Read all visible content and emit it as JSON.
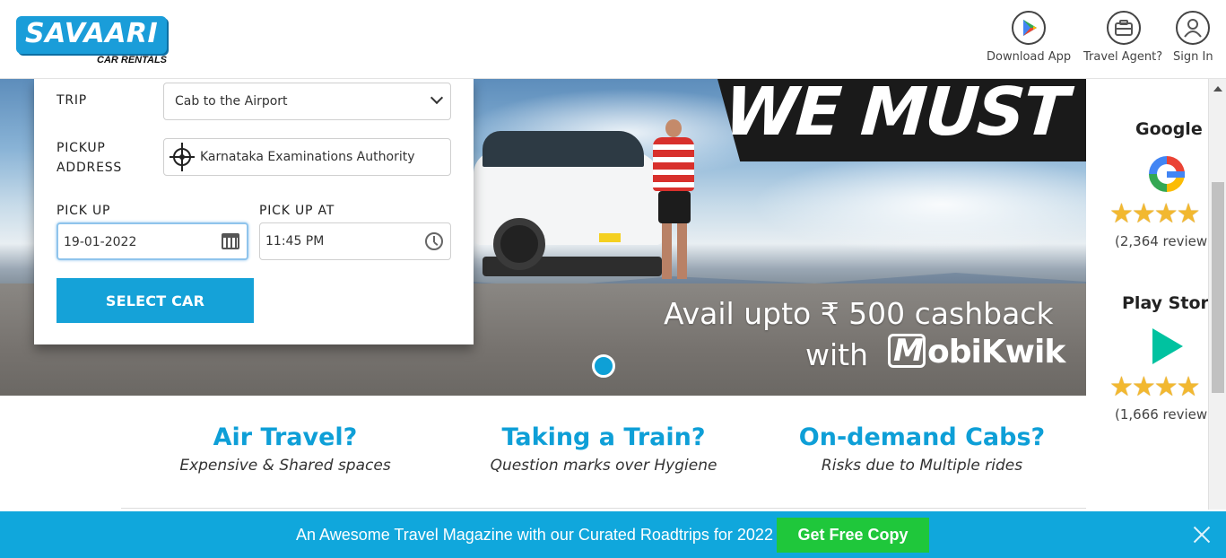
{
  "header": {
    "logo_text": "SAVAARI",
    "logo_sub": "CAR RENTALS",
    "download_label": "Download App",
    "agent_label": "Travel Agent?",
    "signin_label": "Sign In"
  },
  "booking": {
    "trip_label": "TRIP",
    "trip_value": "Cab to the Airport",
    "pickup_address_label_1": "PICKUP",
    "pickup_address_label_2": "ADDRESS",
    "pickup_address_value": "Karnataka Examinations Authority",
    "pickup_label": "PICK UP",
    "pickup_date": "19-01-2022",
    "pickup_at_label": "PICK UP AT",
    "pickup_time": "11:45 PM",
    "select_car_label": "SELECT CAR"
  },
  "banner": {
    "headline": "WE MUST",
    "promo_line1": "Avail upto ₹ 500 cashback",
    "promo_line2": "with",
    "brand": "obiKwik"
  },
  "ratings": {
    "google_title": "Google",
    "google_stars": "★★★★",
    "google_count": "(2,364 review",
    "play_title": "Play Store",
    "play_stars": "★★★★",
    "play_count": "(1,666 review"
  },
  "features": [
    {
      "title": "Air Travel?",
      "subtitle": "Expensive & Shared spaces"
    },
    {
      "title": "Taking a Train?",
      "subtitle": "Question marks over Hygiene"
    },
    {
      "title": "On-demand Cabs?",
      "subtitle": "Risks due to Multiple rides"
    }
  ],
  "promo_bar": {
    "text": "An Awesome Travel Magazine with our Curated Roadtrips for 2022",
    "button_label": "Get Free Copy"
  },
  "colors": {
    "brand_blue": "#15a2d8",
    "cta_green": "#1fc73b",
    "star_gold": "#f2b830"
  }
}
